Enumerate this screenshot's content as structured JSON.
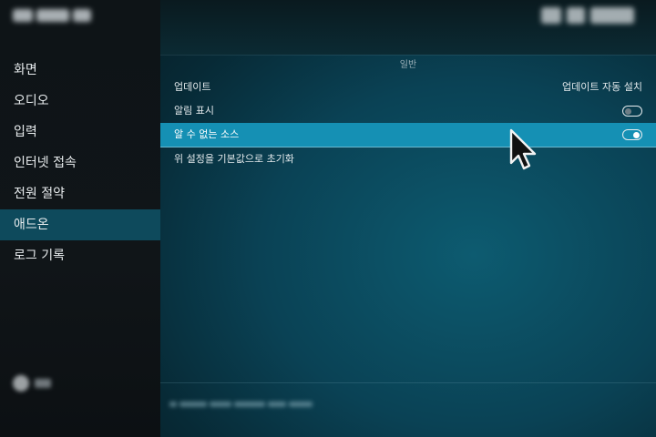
{
  "sidebar": {
    "items": [
      {
        "label": "화면"
      },
      {
        "label": "오디오"
      },
      {
        "label": "입력"
      },
      {
        "label": "인터넷 접속"
      },
      {
        "label": "전원 절약"
      },
      {
        "label": "애드온"
      },
      {
        "label": "로그 기록"
      }
    ],
    "active_index": 5
  },
  "content": {
    "section_title": "일반",
    "rows": [
      {
        "label": "업데이트",
        "value": "업데이트 자동 설치"
      },
      {
        "label": "알림 표시",
        "toggle": "off"
      },
      {
        "label": "알 수 없는 소스",
        "toggle": "on"
      },
      {
        "label": "위 설정을 기본값으로 초기화"
      }
    ]
  },
  "colors": {
    "focus": "#1590b4",
    "sidebar_active": "#0e4a5c"
  },
  "icons": {
    "cursor": "mouse-pointer-icon",
    "settings": "gear-icon"
  }
}
